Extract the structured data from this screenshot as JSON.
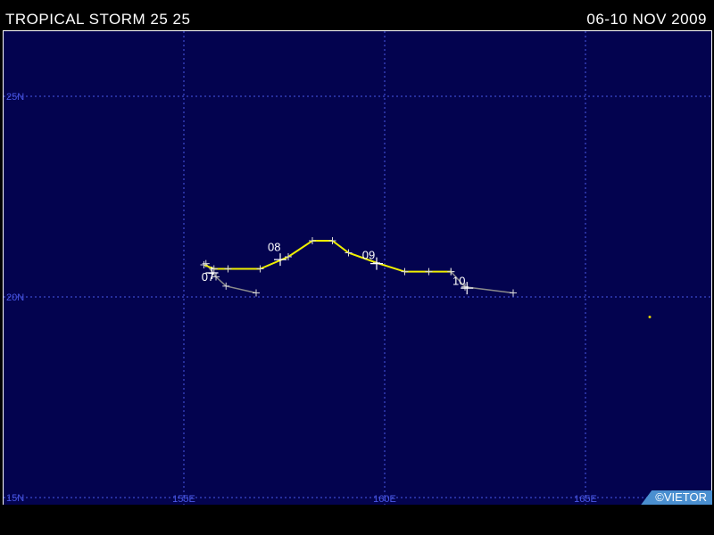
{
  "header": {
    "storm_title": "TROPICAL STORM 25 25",
    "date_range": "06-10 NOV 2009"
  },
  "map": {
    "background_color": "#03034f",
    "grid_color": "#4a58e8",
    "latitude_labels": [
      "25N",
      "20N",
      "15N"
    ],
    "longitude_labels": [
      "155E",
      "160E",
      "165E"
    ],
    "latitude_values": [
      25,
      20,
      15
    ],
    "longitude_values": [
      155,
      160,
      165
    ],
    "extent": {
      "lon_min": 150.5,
      "lon_max": 168.2,
      "lat_min": 15,
      "lat_max": 27.2
    }
  },
  "tracks": {
    "best_track": {
      "color": "#f0f000",
      "points": [
        {
          "lon": 155.5,
          "lat": 20.8
        },
        {
          "lon": 155.75,
          "lat": 20.7
        },
        {
          "lon": 156.1,
          "lat": 20.7
        },
        {
          "lon": 156.9,
          "lat": 20.7
        },
        {
          "lon": 157.6,
          "lat": 21.0
        },
        {
          "lon": 158.2,
          "lat": 21.4
        },
        {
          "lon": 158.7,
          "lat": 21.4
        },
        {
          "lon": 159.1,
          "lat": 21.1
        },
        {
          "lon": 159.8,
          "lat": 20.85
        },
        {
          "lon": 160.5,
          "lat": 20.63
        },
        {
          "lon": 161.1,
          "lat": 20.63
        },
        {
          "lon": 161.65,
          "lat": 20.63
        }
      ]
    },
    "gray_track": {
      "color": "#8a8a8a",
      "points": [
        {
          "lon": 155.55,
          "lat": 20.83
        },
        {
          "lon": 155.8,
          "lat": 20.5
        },
        {
          "lon": 156.05,
          "lat": 20.27
        },
        {
          "lon": 156.8,
          "lat": 20.1
        }
      ]
    },
    "gray_track_east": {
      "color": "#8a8a8a",
      "points": [
        {
          "lon": 161.65,
          "lat": 20.63
        },
        {
          "lon": 162.0,
          "lat": 20.25
        },
        {
          "lon": 163.2,
          "lat": 20.1
        }
      ]
    },
    "date_labels": [
      {
        "text": "07",
        "lon": 155.6,
        "lat": 20.4
      },
      {
        "text": "08",
        "lon": 157.25,
        "lat": 21.15
      },
      {
        "text": "09",
        "lon": 159.6,
        "lat": 20.95
      },
      {
        "text": "10",
        "lon": 161.85,
        "lat": 20.3
      }
    ],
    "daily_markers": [
      {
        "lon": 155.7,
        "lat": 20.6
      },
      {
        "lon": 157.4,
        "lat": 20.93
      },
      {
        "lon": 159.8,
        "lat": 20.83
      },
      {
        "lon": 162.05,
        "lat": 20.22
      }
    ],
    "isolated_point": {
      "lon": 166.6,
      "lat": 19.5,
      "color": "#e0d000"
    }
  },
  "credit": "©VIETOR"
}
